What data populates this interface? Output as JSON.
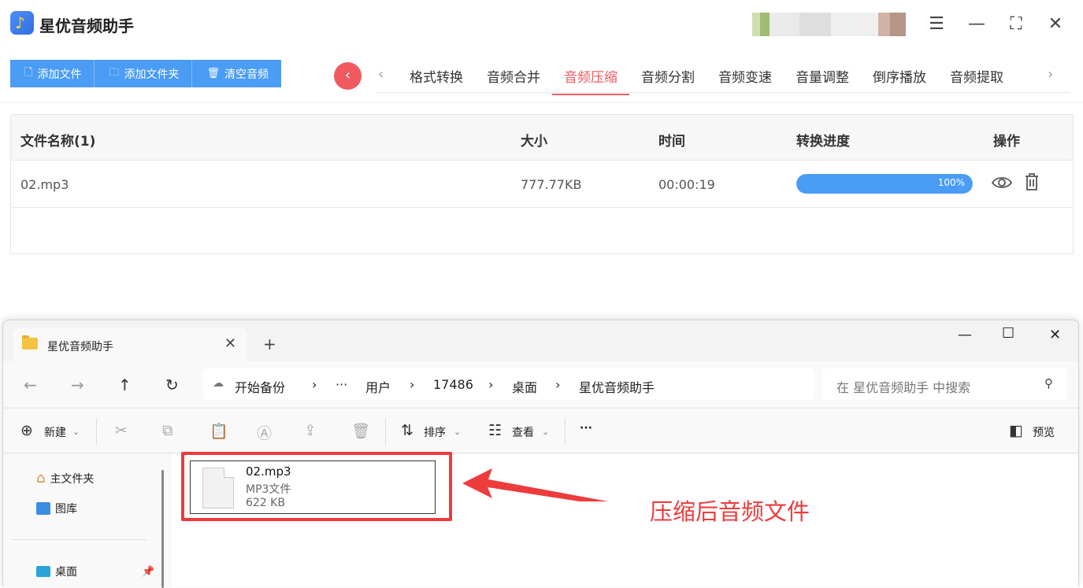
{
  "app": {
    "title": "星优音频助手",
    "buttons": [
      {
        "label": "添加文件",
        "icon": "file-icon"
      },
      {
        "label": "添加文件夹",
        "icon": "folder-icon"
      },
      {
        "label": "清空音频",
        "icon": "trash-icon"
      }
    ],
    "tabs": [
      "格式转换",
      "音频合并",
      "音频压缩",
      "音频分割",
      "音频变速",
      "音量调整",
      "倒序播放",
      "音频提取"
    ],
    "active_tab": "音频压缩",
    "accent_color": "#f05a5f",
    "primary_color": "#4a9cf5",
    "table": {
      "headers": [
        "文件名称(1)",
        "大小",
        "时间",
        "转换进度",
        "操作"
      ],
      "rows": [
        {
          "name": "02.mp3",
          "size": "777.77KB",
          "time": "00:00:19",
          "progress": 100,
          "progress_label": "100%"
        }
      ]
    }
  },
  "explorer": {
    "tab_title": "星优音频助手",
    "breadcrumb": [
      "开始备份",
      "···",
      "用户",
      "17486",
      "桌面",
      "星优音频助手"
    ],
    "search_placeholder": "在 星优音频助手 中搜索",
    "commands": {
      "new": "新建",
      "sort": "排序",
      "view": "查看",
      "more": "···",
      "preview": "预览"
    },
    "sidebar": [
      "主文件夹",
      "图库",
      "桌面"
    ],
    "file": {
      "name": "02.mp3",
      "type": "MP3文件",
      "size": "622 KB"
    },
    "annotation": "压缩后音频文件"
  }
}
